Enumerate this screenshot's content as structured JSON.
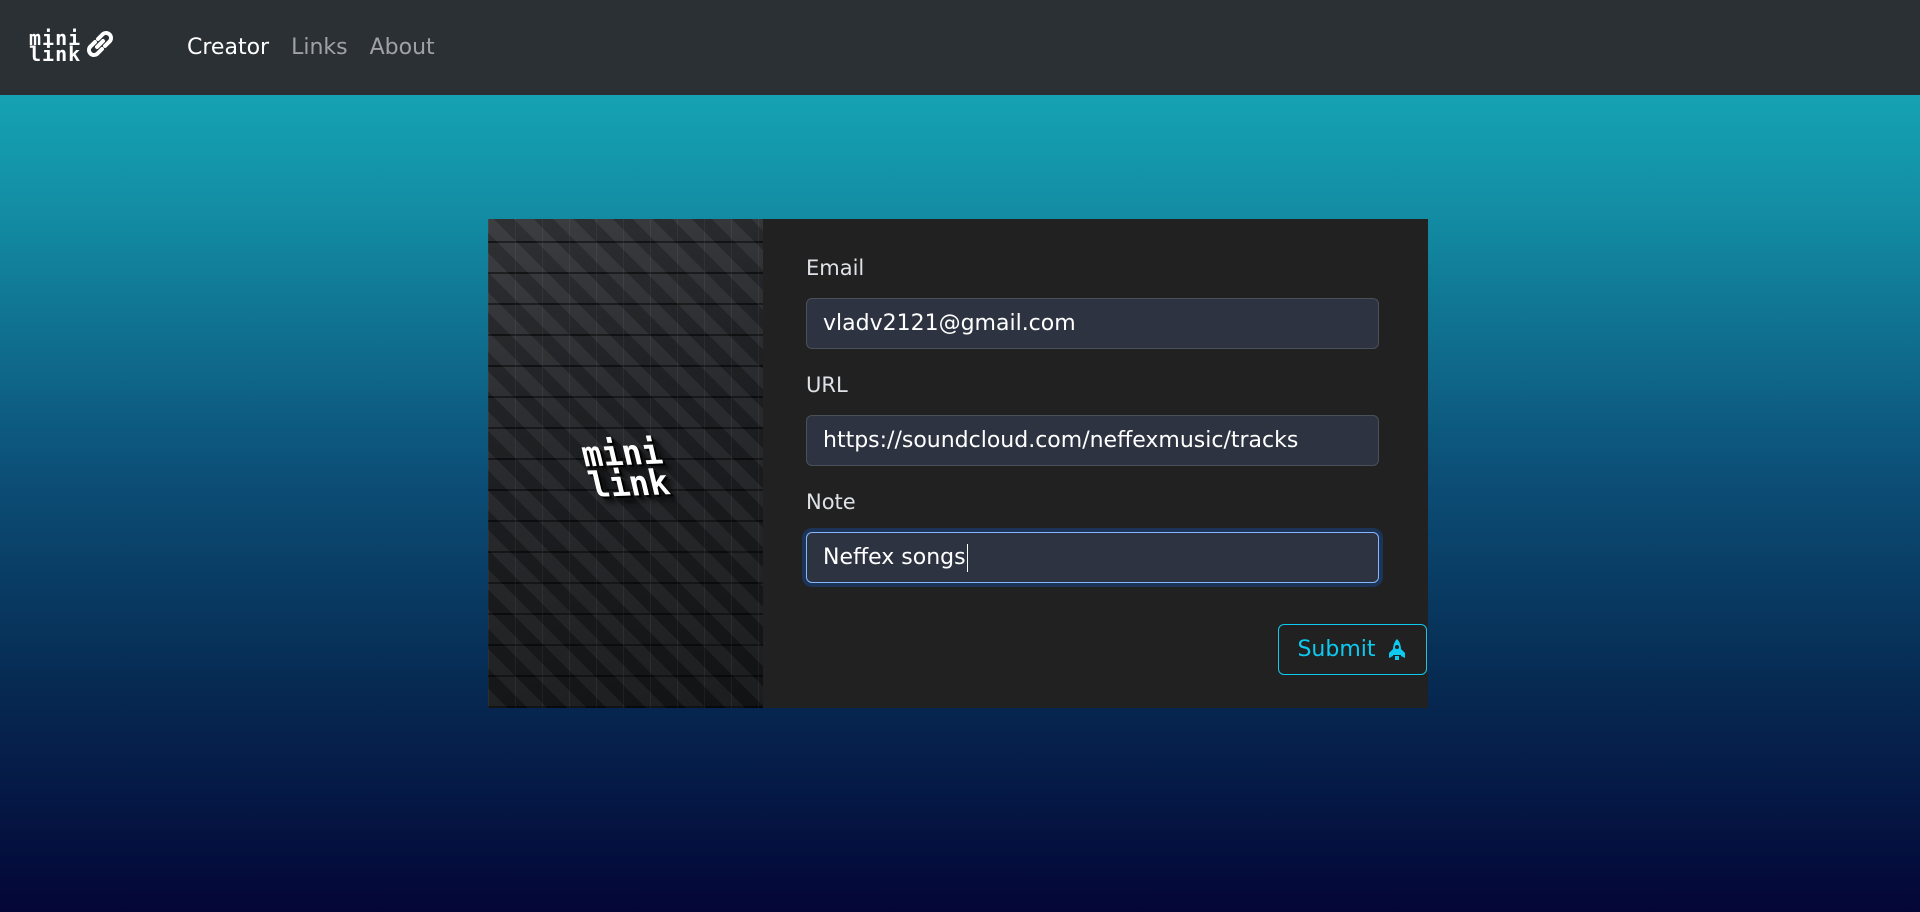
{
  "navbar": {
    "brand_text": "mini\nlink",
    "brand_icon": "link-icon",
    "links": [
      "Creator",
      "Links",
      "About"
    ]
  },
  "card": {
    "image_alt": "minilink logo on black cubes"
  },
  "form": {
    "email_label": "Email",
    "email_value": "vladv2121@gmail.com",
    "url_label": "URL",
    "url_value": "https://soundcloud.com/neffexmusic/tracks",
    "note_label": "Note",
    "note_value": "Neffex songs",
    "submit_label": "Submit",
    "submit_icon": "rocket-icon"
  },
  "colors": {
    "navbar": "#2b3035",
    "card": "#212121",
    "input": "#2d3340",
    "accent": "#0dcaf0"
  }
}
